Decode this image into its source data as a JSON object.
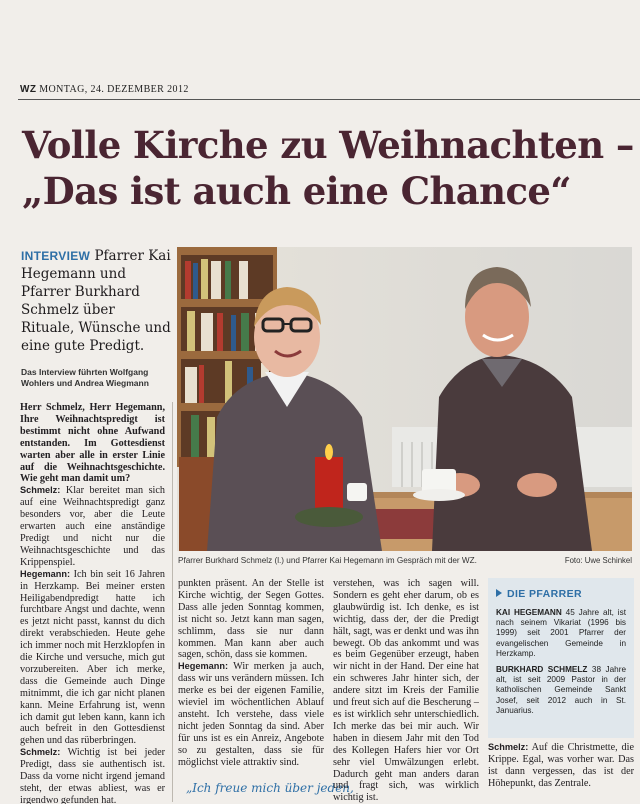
{
  "masthead": {
    "paper": "WZ",
    "date": "MONTAG, 24. DEZEMBER 2012"
  },
  "headline": {
    "line1": "Volle Kirche zu Weihnachten –",
    "line2": "„Das ist auch eine Chance“"
  },
  "teaser": {
    "kicker": "INTERVIEW",
    "text": "Pfarrer Kai Hegemann und Pfarrer Burkhard Schmelz über Rituale, Wünsche und eine gute Predigt."
  },
  "byline": "Das Interview führten Wolfgang Wohlers und Andrea Wiegmann",
  "col1": [
    {
      "speaker": "",
      "q": true,
      "text": "Herr Schmelz, Herr Hegemann, Ihre Weihnachtspredigt ist bestimmt nicht ohne Aufwand entstanden. Im Gottesdienst warten aber alle in erster Linie auf die Weihnachtsgeschichte. Wie geht man damit um?"
    },
    {
      "speaker": "Schmelz:",
      "q": false,
      "text": "Klar bereitet man sich auf eine Weihnachtspredigt ganz besonders vor, aber die Leute erwarten auch eine anständige Predigt und nicht nur die Weihnachtsgeschichte und das Krippenspiel."
    },
    {
      "speaker": "Hegemann:",
      "q": false,
      "text": "Ich bin seit 16 Jahren in Herzkamp. Bei meiner ersten Heiligabendpredigt hatte ich furchtbare Angst und dachte, wenn es jetzt nicht passt, kannst du dich direkt verabschieden. Heute gehe ich immer noch mit Herzklopfen in die Kirche und versuche, mich gut vorzubereiten. Aber ich merke, dass die Gemeinde auch Dinge mitnimmt, die ich gar nicht planen kann. Meine Erfahrung ist, wenn ich damit gut leben kann, kann ich auch befreit in den Gottesdienst gehen und das rüberbringen."
    },
    {
      "speaker": "Schmelz:",
      "q": false,
      "text": "Wichtig ist bei jeder Predigt, dass sie authentisch ist. Dass da vorne nicht irgend jemand steht, der etwas abliest, was er irgendwo gefunden hat."
    }
  ],
  "col2": [
    {
      "speaker": "",
      "text": "punkten präsent. An der Stelle ist Kirche wichtig, der Segen Gottes. Dass alle jeden Sonntag kommen, ist nicht so. Jetzt kann man sagen, schlimm, dass sie nur dann kommen. Man kann aber auch sagen, schön, dass sie kommen."
    },
    {
      "speaker": "Hegemann:",
      "text": "Wir merken ja auch, dass wir uns verändern müssen. Ich merke es bei der eigenen Familie, wieviel im wöchentlichen Ablauf ansteht. Ich verstehe, dass viele nicht jeden Sonntag da sind. Aber für uns ist es ein Anreiz, Angebote so zu gestalten, dass sie für möglichst viele attraktiv sind."
    }
  ],
  "pullquote": "„Ich freue mich über jeden,",
  "col3": [
    {
      "speaker": "",
      "text": "verstehen, was ich sagen will. Sondern es geht eher darum, ob es glaubwürdig ist. Ich denke, es ist wichtig, dass der, der die Predigt hält, sagt, was er denkt und was ihn bewegt. Ob das ankommt und was es beim Gegenüber erzeugt, haben wir nicht in der Hand. Der eine hat ein schweres Jahr hinter sich, der andere sitzt im Kreis der Familie und freut sich auf die Bescherung – es ist wirklich sehr unterschiedlich. Ich merke das bei mir auch. Wir haben in diesem Jahr mit den Tod des Kollegen Hafers hier vor Ort sehr viel Umwälzungen erlebt. Dadurch geht man anders daran und fragt sich, was wirklich wichtig ist."
    }
  ],
  "photo": {
    "caption": "Pfarrer Burkhard Schmelz (l.) und Pfarrer Kai Hegemann im Gespräch mit der WZ.",
    "credit": "Foto: Uwe Schinkel"
  },
  "sidebar": {
    "title": "DIE PFARRER",
    "entries": [
      {
        "name": "KAI HEGEMANN",
        "text": "45 Jahre alt, ist nach seinem Vikariat (1996 bis 1999) seit 2001 Pfarrer der evangelischen Gemeinde in Herzkamp."
      },
      {
        "name": "BURKHARD SCHMELZ",
        "text": "38 Jahre alt, ist seit 2009 Pastor in der katholischen Gemeinde Sankt Josef, seit 2012 auch in St. Januarius."
      }
    ]
  },
  "col4": [
    {
      "speaker": "Schmelz:",
      "text": "Auf die Christmette, die Krippe. Egal, was vorher war. Das ist dann vergessen, das ist der Höhepunkt, das Zentrale."
    }
  ],
  "colors": {
    "headline": "#4a2532",
    "accent": "#2e6fa6",
    "sidebar_bg": "#e0e7ec",
    "paper": "#f1eeea"
  }
}
